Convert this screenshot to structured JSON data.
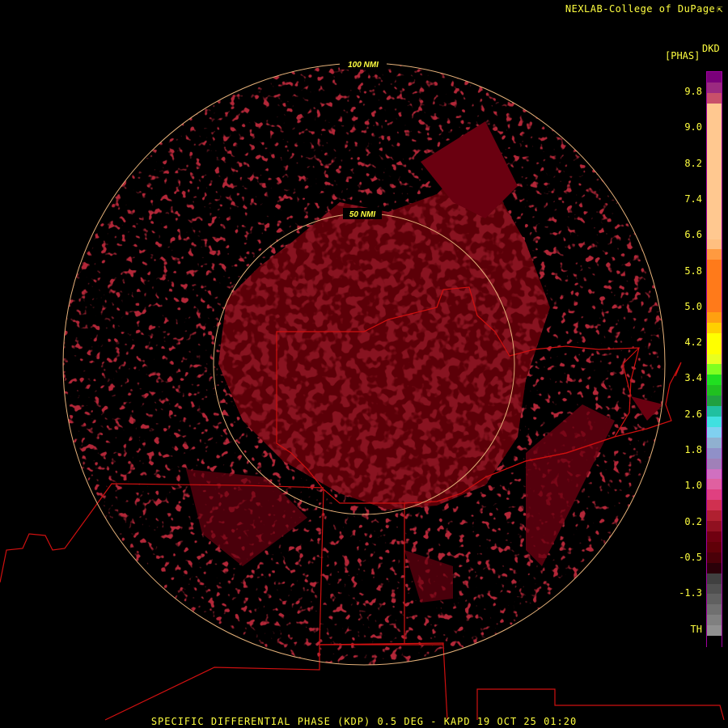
{
  "credit": "NEXLAB-College of DuPage",
  "credit_icon": "external-link-icon",
  "product_abbr": "DKD",
  "product_unit": "[PHAS]",
  "range_rings": [
    "100 NMI",
    "50 NMI"
  ],
  "legend": {
    "ticks": [
      "9.8",
      "9.0",
      "8.2",
      "7.4",
      "6.6",
      "5.8",
      "5.0",
      "4.2",
      "3.4",
      "2.6",
      "1.8",
      "1.0",
      "0.2",
      "-0.5",
      "-1.3",
      "TH"
    ],
    "colors": [
      "#7a007a",
      "#9b2a80",
      "#c8506a",
      "#ffc890",
      "#ffc890",
      "#ffc890",
      "#ffc890",
      "#ffc890",
      "#ffc890",
      "#ffc890",
      "#ffc890",
      "#ffc890",
      "#ffc890",
      "#ffc890",
      "#ffc890",
      "#ffc890",
      "#ffbf80",
      "#ff9a40",
      "#ff7a1a",
      "#ff7a1a",
      "#ff7a1a",
      "#ff7a1a",
      "#ff7a1a",
      "#ffa010",
      "#ffd000",
      "#ffff00",
      "#ffff00",
      "#e8ff20",
      "#80ff20",
      "#20e020",
      "#20c020",
      "#20a040",
      "#20c0a0",
      "#40e0e0",
      "#80d0f0",
      "#90b0d0",
      "#9090c8",
      "#a080b8",
      "#d070c0",
      "#e060a0",
      "#e04080",
      "#d03050",
      "#b02030",
      "#901020",
      "#700010",
      "#600008",
      "#4a0008",
      "#2a0008",
      "#404040",
      "#505050",
      "#606060",
      "#707070",
      "#808080",
      "#909090",
      "#000000"
    ]
  },
  "footer": "SPECIFIC DIFFERENTIAL PHASE (KDP) 0.5 DEG - KAPD 19 OCT 25 01:20"
}
